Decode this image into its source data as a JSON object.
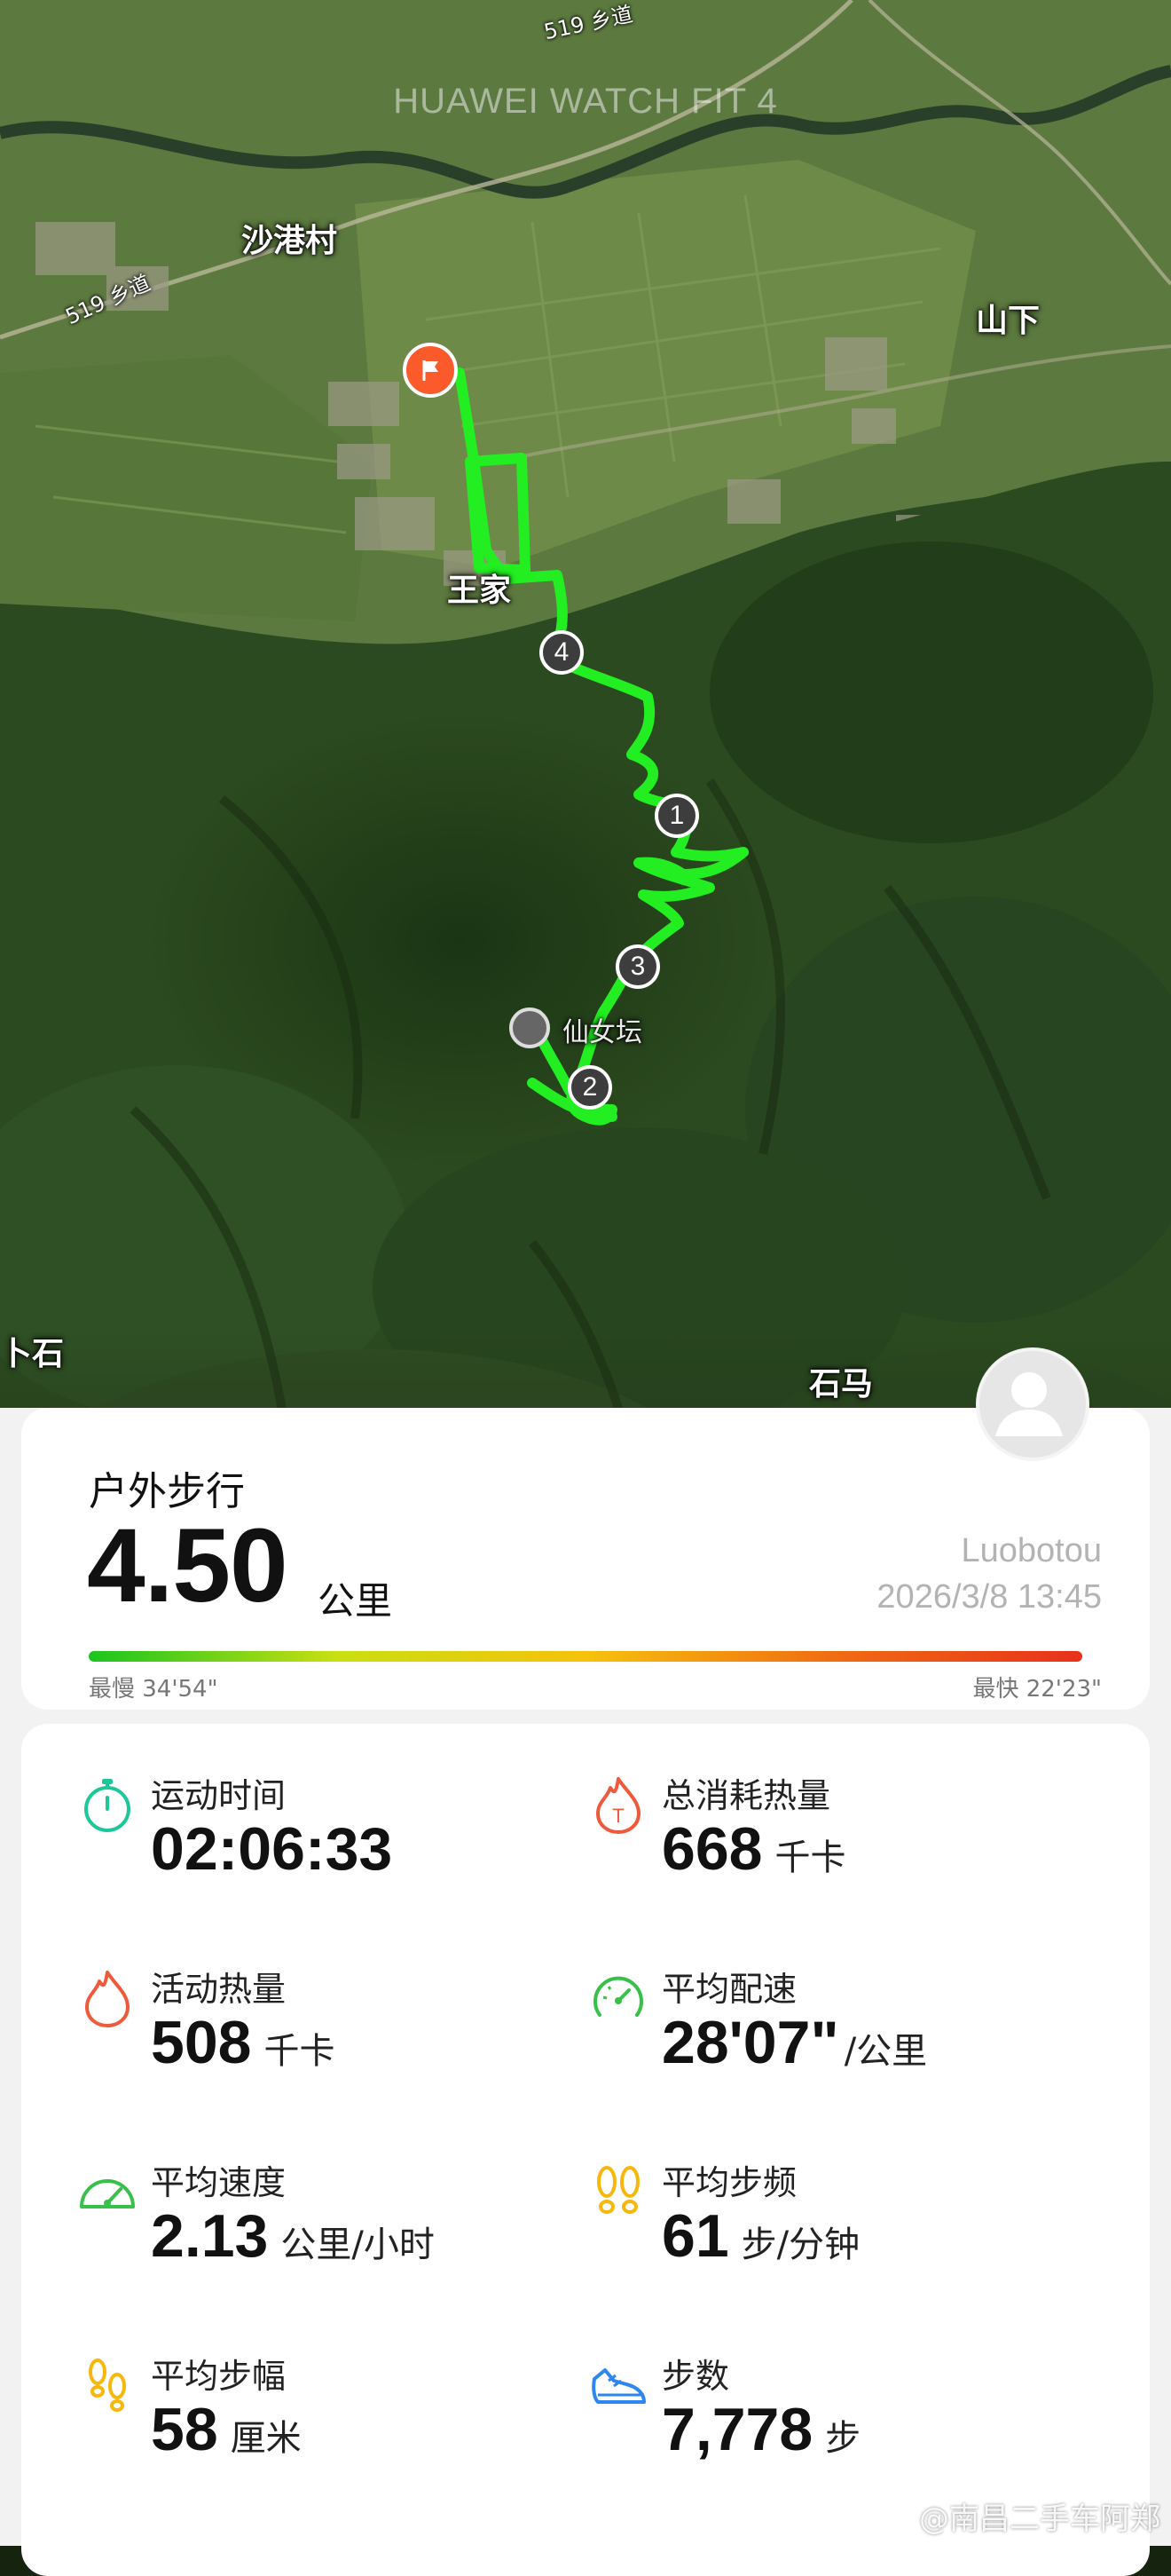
{
  "map": {
    "watermark": "HUAWEI WATCH FIT 4",
    "places": {
      "shagang": "沙港村",
      "shanxia": "山下",
      "wangjia": "王家",
      "xiannv": "仙女坛",
      "shima": "石马",
      "left_edge": "卜石"
    },
    "roads": [
      "519 乡道",
      "519 乡道"
    ],
    "km_markers": [
      "1",
      "2",
      "3",
      "4"
    ]
  },
  "workout": {
    "type": "户外步行",
    "distance": "4.50",
    "distance_unit": "公里",
    "location": "Luobotou",
    "datetime": "2026/3/8 13:45",
    "slowest_pace": "最慢 34'54\"",
    "fastest_pace": "最快 22'23\""
  },
  "stats": [
    {
      "label": "运动时间",
      "value": "02:06:33",
      "unit": "",
      "icon": "stopwatch-icon",
      "color": "#1ec79a"
    },
    {
      "label": "总消耗热量",
      "value": "668",
      "unit": "千卡",
      "icon": "total-calories-flame-icon",
      "color": "#f05a3c"
    },
    {
      "label": "活动热量",
      "value": "508",
      "unit": "千卡",
      "icon": "active-calories-flame-icon",
      "color": "#f05a3c"
    },
    {
      "label": "平均配速",
      "value": "28'07\"",
      "unit": "/公里",
      "icon": "pace-gauge-icon",
      "color": "#38c04a"
    },
    {
      "label": "平均速度",
      "value": "2.13",
      "unit": "公里/小时",
      "icon": "speedometer-icon",
      "color": "#38c04a"
    },
    {
      "label": "平均步频",
      "value": "61",
      "unit": "步/分钟",
      "icon": "cadence-footprints-icon",
      "color": "#f6b80c"
    },
    {
      "label": "平均步幅",
      "value": "58",
      "unit": "厘米",
      "icon": "stride-footprints-icon",
      "color": "#f6b80c"
    },
    {
      "label": "步数",
      "value": "7,778",
      "unit": "步",
      "icon": "shoe-icon",
      "color": "#2e86f0"
    }
  ],
  "pace_gradient": [
    "#19c51f",
    "#c9df12",
    "#f6c20c",
    "#f06c12",
    "#e8311c"
  ],
  "credit": "@南昌二手车阿郑"
}
